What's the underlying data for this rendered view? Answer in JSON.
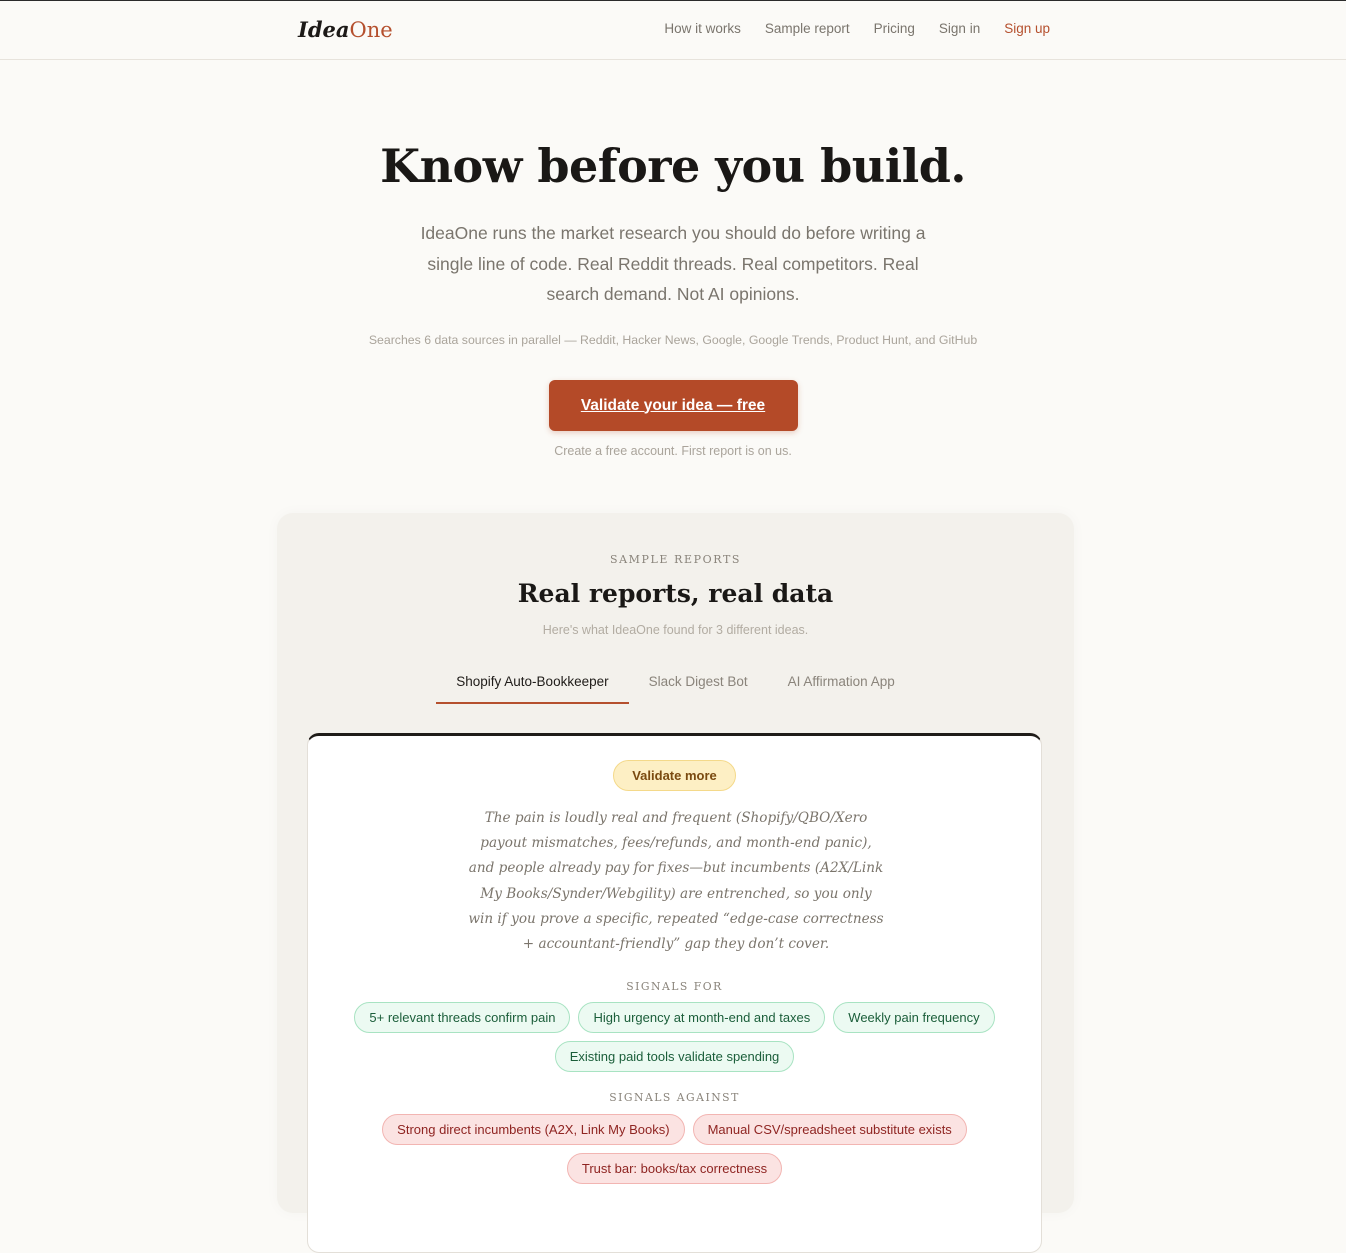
{
  "brand": {
    "name_part1": "Idea",
    "name_part2": "One"
  },
  "nav": {
    "items": [
      "How it works",
      "Sample report",
      "Pricing",
      "Sign in"
    ],
    "signup": "Sign up"
  },
  "hero": {
    "title": "Know before you build.",
    "subtitle": "IdeaOne runs the market research you should do before writing a single line of code. Real Reddit threads. Real competitors. Real search demand. Not AI opinions.",
    "sources_note": "Searches 6 data sources in parallel — Reddit, Hacker News, Google, Google Trends, Product Hunt, and GitHub",
    "cta_label": "Validate your idea — free",
    "fineprint": "Create a free account. First report is on us."
  },
  "samples": {
    "eyebrow": "SAMPLE REPORTS",
    "title": "Real reports, real data",
    "subtitle": "Here's what IdeaOne found for 3 different ideas.",
    "tabs": [
      "Shopify Auto-Bookkeeper",
      "Slack Digest Bot",
      "AI Affirmation App"
    ],
    "active_tab": 0,
    "report": {
      "verdict": "Validate more",
      "summary": "The pain is loudly real and frequent (Shopify/QBO/Xero payout mismatches, fees/refunds, and month-end panic), and people already pay for fixes—but incumbents (A2X/Link My Books/Synder/Webgility) are entrenched, so you only win if you prove a specific, repeated “edge-case correctness + accountant-friendly” gap they don’t cover.",
      "signals_for_title": "SIGNALS FOR",
      "signals_for": [
        "5+ relevant threads confirm pain",
        "High urgency at month-end and taxes",
        "Weekly pain frequency",
        "Existing paid tools validate spending"
      ],
      "signals_against_title": "SIGNALS AGAINST",
      "signals_against": [
        "Strong direct incumbents (A2X, Link My Books)",
        "Manual CSV/spreadsheet substitute exists",
        "Trust bar: books/tax correctness"
      ]
    }
  },
  "colors": {
    "accent": "#b44a28",
    "background": "#fbfaf7",
    "panel": "#f3f1ec",
    "verdict_bg": "#fdefc4",
    "signal_for_bg": "#ecfaf2",
    "signal_against_bg": "#fbe3e2"
  }
}
